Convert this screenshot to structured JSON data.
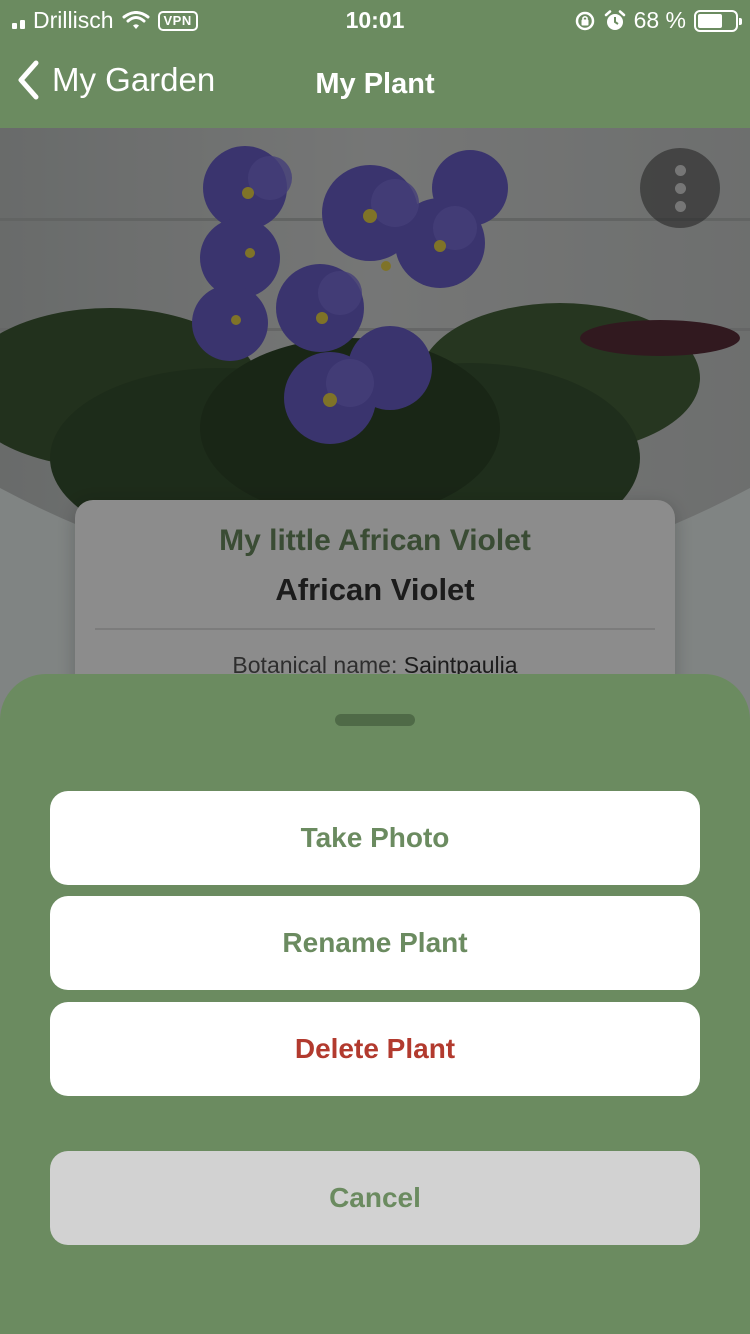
{
  "status_bar": {
    "carrier": "Drillisch",
    "vpn": "VPN",
    "time": "10:01",
    "battery": "68 %",
    "battery_level": 0.68
  },
  "nav": {
    "back_label": "My Garden",
    "title": "My Plant"
  },
  "plant": {
    "nickname": "My little African Violet",
    "common_name": "African Violet",
    "botanical_label": "Botanical name:",
    "botanical_value": "Saintpaulia"
  },
  "sheet": {
    "actions": [
      {
        "label": "Take Photo"
      },
      {
        "label": "Rename Plant"
      },
      {
        "label": "Delete Plant"
      }
    ],
    "cancel_label": "Cancel"
  },
  "colors": {
    "brand_green": "#6b8b60",
    "destructive_red": "#b23a2e",
    "cancel_gray": "#d2d2d2"
  }
}
